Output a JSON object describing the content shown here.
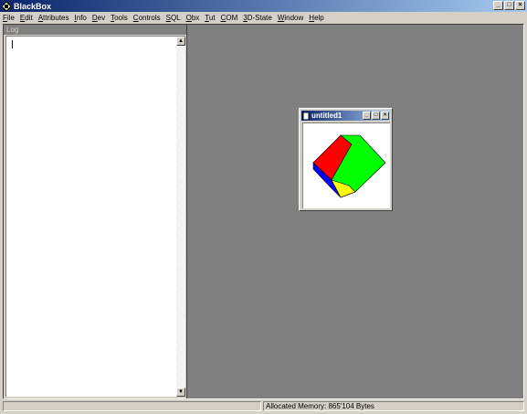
{
  "window": {
    "title": "BlackBox",
    "icon": "blackbox-icon"
  },
  "menu": {
    "items": [
      {
        "u": "F",
        "rest": "ile"
      },
      {
        "u": "E",
        "rest": "dit"
      },
      {
        "u": "A",
        "rest": "ttributes"
      },
      {
        "u": "I",
        "rest": "nfo"
      },
      {
        "u": "D",
        "rest": "ev"
      },
      {
        "u": "T",
        "rest": "ools"
      },
      {
        "u": "C",
        "rest": "ontrols"
      },
      {
        "u": "S",
        "rest": "QL"
      },
      {
        "u": "O",
        "rest": "bx"
      },
      {
        "u": "T",
        "rest": "ut"
      },
      {
        "u": "C",
        "rest": "OM"
      },
      {
        "u": "3",
        "rest": "D-State"
      },
      {
        "u": "W",
        "rest": "indow"
      },
      {
        "u": "H",
        "rest": "elp"
      }
    ]
  },
  "log": {
    "title": "Log"
  },
  "child": {
    "title": "untitled1"
  },
  "cube": {
    "top": "#ff0000",
    "left": "#0000ff",
    "right": "#00ff00",
    "bottom": "#ffff00"
  },
  "status": {
    "memory": "Allocated Memory: 865'104 Bytes"
  }
}
